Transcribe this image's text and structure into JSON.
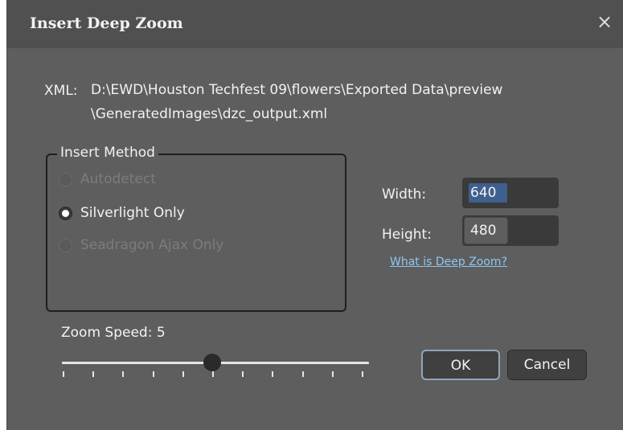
{
  "dialog": {
    "title": "Insert Deep Zoom",
    "close_icon": "×"
  },
  "xml": {
    "label": "XML:",
    "path_line1": "D:\\EWD\\Houston Techfest 09\\flowers\\Exported Data\\preview",
    "path_line2": "\\GeneratedImages\\dzc_output.xml"
  },
  "insert_method": {
    "legend": "Insert Method",
    "options": [
      {
        "label": "Autodetect",
        "enabled": false,
        "checked": false
      },
      {
        "label": "Silverlight Only",
        "enabled": true,
        "checked": true
      },
      {
        "label": "Seadragon Ajax Only",
        "enabled": false,
        "checked": false
      }
    ]
  },
  "size": {
    "width_label": "Width:",
    "width_value": "640",
    "height_label": "Height:",
    "height_value": "480"
  },
  "help_link": "What is Deep Zoom?",
  "zoom": {
    "label": "Zoom Speed: 5",
    "value": 5,
    "min": 0,
    "max": 10
  },
  "buttons": {
    "ok": "OK",
    "cancel": "Cancel"
  },
  "colors": {
    "dialog_bg": "#5e5e5e",
    "titlebar_bg": "#505050",
    "link": "#8fc6f0",
    "selection": "#3f5f8e"
  }
}
